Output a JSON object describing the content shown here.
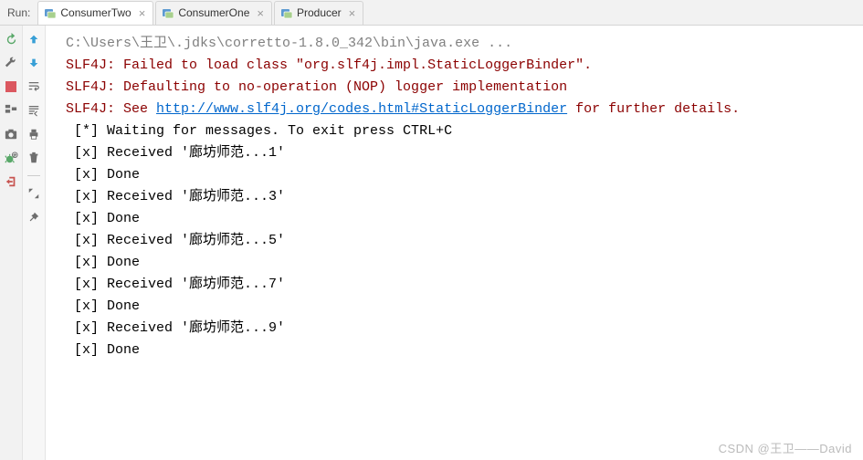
{
  "header": {
    "run_label": "Run:",
    "tabs": [
      {
        "name": "ConsumerTwo",
        "active": true
      },
      {
        "name": "ConsumerOne",
        "active": false
      },
      {
        "name": "Producer",
        "active": false
      }
    ]
  },
  "toolbar_left": {
    "icons": [
      "rerun",
      "wrench",
      "stop",
      "debug-tree",
      "camera",
      "bug-settings",
      "exit"
    ]
  },
  "toolbar_inner": {
    "icons": [
      "arrow-up",
      "arrow-down",
      "wrap-text",
      "scroll-to-end",
      "print",
      "delete",
      "divider",
      "expand",
      "pin"
    ]
  },
  "console": {
    "lines": [
      {
        "segments": [
          {
            "text": "C:\\Users\\王卫\\.jdks\\corretto-1.8.0_342\\bin\\java.exe ...",
            "cls": "gray"
          }
        ]
      },
      {
        "segments": [
          {
            "text": "SLF4J: Failed to load class \"org.slf4j.impl.StaticLoggerBinder\".",
            "cls": "red"
          }
        ]
      },
      {
        "segments": [
          {
            "text": "SLF4J: Defaulting to no-operation (NOP) logger implementation",
            "cls": "red"
          }
        ]
      },
      {
        "segments": [
          {
            "text": "SLF4J: See ",
            "cls": "red"
          },
          {
            "text": "http://www.slf4j.org/codes.html#StaticLoggerBinder",
            "cls": "link"
          },
          {
            "text": " for further details.",
            "cls": "red"
          }
        ]
      },
      {
        "segments": [
          {
            "text": " [*] Waiting for messages. To exit press CTRL+C",
            "cls": "black"
          }
        ]
      },
      {
        "segments": [
          {
            "text": " [x] Received '廊坊师范...1'",
            "cls": "black"
          }
        ]
      },
      {
        "segments": [
          {
            "text": " [x] Done",
            "cls": "black"
          }
        ]
      },
      {
        "segments": [
          {
            "text": " [x] Received '廊坊师范...3'",
            "cls": "black"
          }
        ]
      },
      {
        "segments": [
          {
            "text": " [x] Done",
            "cls": "black"
          }
        ]
      },
      {
        "segments": [
          {
            "text": " [x] Received '廊坊师范...5'",
            "cls": "black"
          }
        ]
      },
      {
        "segments": [
          {
            "text": " [x] Done",
            "cls": "black"
          }
        ]
      },
      {
        "segments": [
          {
            "text": " [x] Received '廊坊师范...7'",
            "cls": "black"
          }
        ]
      },
      {
        "segments": [
          {
            "text": " [x] Done",
            "cls": "black"
          }
        ]
      },
      {
        "segments": [
          {
            "text": " [x] Received '廊坊师范...9'",
            "cls": "black"
          }
        ]
      },
      {
        "segments": [
          {
            "text": " [x] Done",
            "cls": "black"
          }
        ]
      }
    ]
  },
  "watermark": "CSDN @王卫——David"
}
